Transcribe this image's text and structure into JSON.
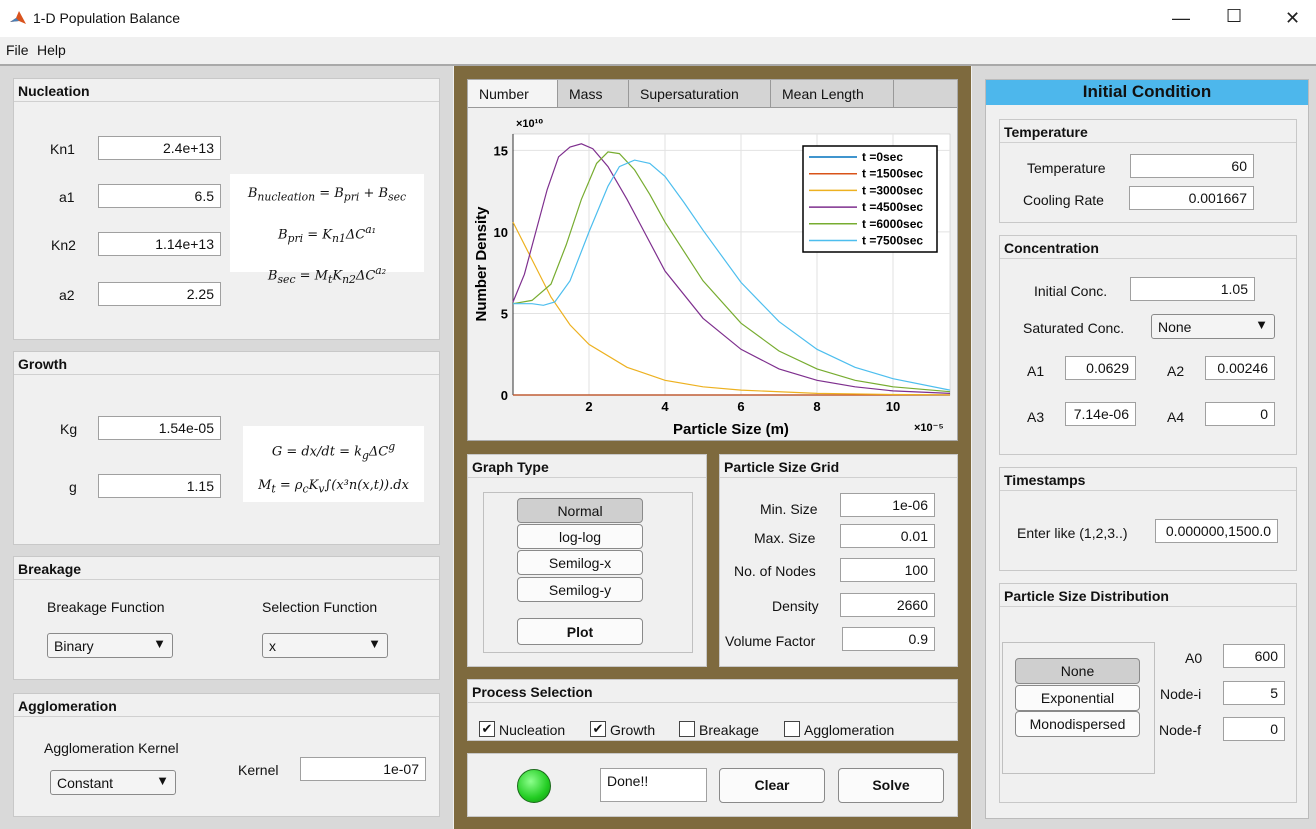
{
  "window": {
    "title": "1-D Population Balance",
    "min": "—",
    "max": "☐",
    "close": "✕"
  },
  "menu": [
    "File",
    "Help"
  ],
  "nucleation": {
    "title": "Nucleation",
    "fields": [
      {
        "label": "Kn1",
        "value": "2.4e+13"
      },
      {
        "label": "a1",
        "value": "6.5"
      },
      {
        "label": "Kn2",
        "value": "1.14e+13"
      },
      {
        "label": "a2",
        "value": "2.25"
      }
    ]
  },
  "growth": {
    "title": "Growth",
    "fields": [
      {
        "label": "Kg",
        "value": "1.54e-05"
      },
      {
        "label": "g",
        "value": "1.15"
      }
    ]
  },
  "breakage": {
    "title": "Breakage",
    "function_label": "Breakage Function",
    "function_value": "Binary",
    "selection_label": "Selection Function",
    "selection_value": "x"
  },
  "agglomeration": {
    "title": "Agglomeration",
    "kernel_type_label": "Agglomeration Kernel",
    "kernel_type_value": "Constant",
    "kernel_label": "Kernel",
    "kernel_value": "1e-07"
  },
  "tabs": [
    "Number",
    "Mass",
    "Supersaturation",
    "Mean Length"
  ],
  "graph_type": {
    "title": "Graph Type",
    "options": [
      "Normal",
      "log-log",
      "Semilog-x",
      "Semilog-y"
    ],
    "selected": "Normal",
    "plot_label": "Plot"
  },
  "grid": {
    "title": "Particle Size Grid",
    "fields": [
      {
        "label": "Min. Size",
        "value": "1e-06"
      },
      {
        "label": "Max. Size",
        "value": "0.01"
      },
      {
        "label": "No. of Nodes",
        "value": "100"
      },
      {
        "label": "Density",
        "value": "2660"
      },
      {
        "label": "Volume Factor",
        "value": "0.9"
      }
    ]
  },
  "process": {
    "title": "Process Selection",
    "items": [
      {
        "label": "Nucleation",
        "checked": true
      },
      {
        "label": "Growth",
        "checked": true
      },
      {
        "label": "Breakage",
        "checked": false
      },
      {
        "label": "Agglomeration",
        "checked": false
      }
    ]
  },
  "status": {
    "text": "Done!!",
    "clear_label": "Clear",
    "solve_label": "Solve",
    "lamp_color": "#22cc22"
  },
  "initial": {
    "header": "Initial Condition",
    "temperature": {
      "title": "Temperature",
      "temp_label": "Temperature",
      "temp_value": "60",
      "rate_label": "Cooling Rate",
      "rate_value": "0.001667"
    },
    "concentration": {
      "title": "Concentration",
      "init_label": "Initial Conc.",
      "init_value": "1.05",
      "sat_label": "Saturated Conc.",
      "sat_value": "None",
      "A1_label": "A1",
      "A1": "0.0629",
      "A2_label": "A2",
      "A2": "0.00246",
      "A3_label": "A3",
      "A3": "7.14e-06",
      "A4_label": "A4",
      "A4": "0"
    },
    "timestamps": {
      "title": "Timestamps",
      "label": "Enter like (1,2,3..)",
      "value": "0.000000,1500.0"
    },
    "psd": {
      "title": "Particle Size Distribution",
      "options": [
        "None",
        "Exponential",
        "Monodispersed"
      ],
      "selected": "None",
      "A0_label": "A0",
      "A0": "600",
      "nodei_label": "Node-i",
      "nodei": "5",
      "nodef_label": "Node-f",
      "nodef": "0"
    }
  },
  "chart_data": {
    "type": "line",
    "xlabel": "Particle Size (m)",
    "ylabel": "Number Density",
    "x_multiplier": "×10⁻⁵",
    "y_multiplier": "×10¹⁰",
    "xlim": [
      0,
      11.5
    ],
    "ylim": [
      0,
      16
    ],
    "xticks": [
      2,
      4,
      6,
      8,
      10
    ],
    "yticks": [
      0,
      5,
      10,
      15
    ],
    "legend_position": "top-right",
    "series": [
      {
        "name": "t =0sec",
        "color": "#0072BD",
        "x": [
          0,
          2,
          4,
          6,
          8,
          10,
          11.5
        ],
        "y": [
          0,
          0,
          0,
          0,
          0,
          0,
          0
        ]
      },
      {
        "name": "t =1500sec",
        "color": "#D95319",
        "x": [
          0,
          2,
          4,
          6,
          8,
          10,
          11.5
        ],
        "y": [
          0,
          0,
          0,
          0,
          0,
          0,
          0
        ]
      },
      {
        "name": "t =3000sec",
        "color": "#EDB120",
        "x": [
          0,
          0.5,
          1,
          1.5,
          2,
          3,
          4,
          5,
          6,
          8,
          10,
          11.5
        ],
        "y": [
          10.6,
          8.3,
          6.0,
          4.3,
          3.1,
          1.7,
          0.9,
          0.5,
          0.3,
          0.1,
          0.03,
          0.01
        ]
      },
      {
        "name": "t =4500sec",
        "color": "#7E2F8E",
        "x": [
          0,
          0.3,
          0.6,
          0.9,
          1.2,
          1.5,
          1.8,
          2.1,
          2.5,
          3,
          3.5,
          4,
          5,
          6,
          7,
          8,
          9,
          10,
          11.5
        ],
        "y": [
          5.7,
          7.4,
          10.0,
          12.6,
          14.6,
          15.2,
          15.4,
          15.1,
          14.0,
          12.0,
          9.8,
          7.6,
          4.7,
          2.8,
          1.6,
          0.9,
          0.5,
          0.25,
          0.1
        ]
      },
      {
        "name": "t =6000sec",
        "color": "#77AC30",
        "x": [
          0,
          0.5,
          1,
          1.4,
          1.8,
          2.2,
          2.5,
          2.8,
          3.2,
          3.6,
          4,
          5,
          6,
          7,
          8,
          9,
          10,
          11.5
        ],
        "y": [
          5.6,
          5.8,
          6.8,
          9.2,
          12.0,
          14.2,
          14.9,
          14.8,
          13.8,
          12.3,
          10.6,
          7.0,
          4.4,
          2.7,
          1.6,
          0.9,
          0.5,
          0.2
        ]
      },
      {
        "name": "t =7500sec",
        "color": "#4DBEEE",
        "x": [
          0,
          0.5,
          0.8,
          1.1,
          1.5,
          2,
          2.5,
          2.8,
          3.2,
          3.6,
          4,
          4.5,
          5,
          6,
          7,
          8,
          9,
          10,
          11.5
        ],
        "y": [
          5.6,
          5.6,
          5.5,
          5.7,
          7.0,
          10.0,
          12.8,
          14.0,
          14.4,
          14.2,
          13.4,
          11.8,
          10.1,
          6.9,
          4.5,
          2.8,
          1.7,
          1.0,
          0.3
        ]
      }
    ]
  }
}
